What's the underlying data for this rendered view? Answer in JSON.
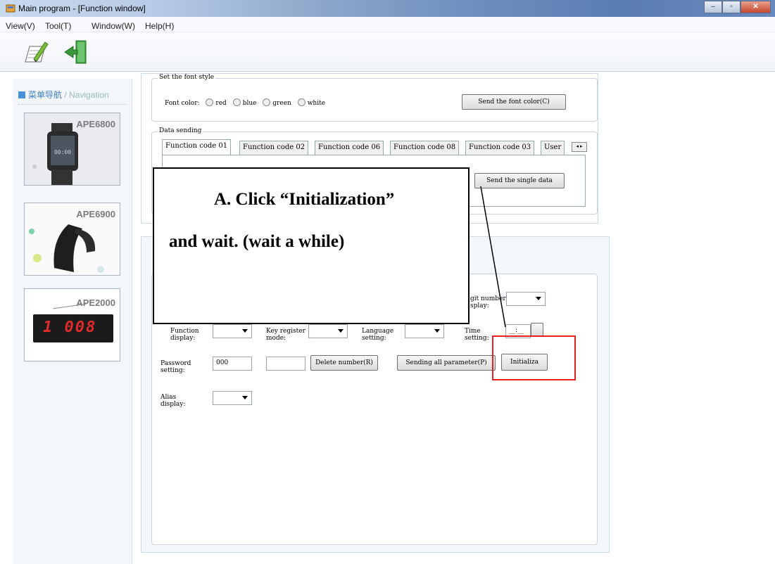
{
  "window": {
    "title": "Main program - [Function window]",
    "min": "–",
    "max": "▫",
    "close": "✕"
  },
  "menu": [
    "View(V)",
    "Tool(T)",
    "Window(W)",
    "Help(H)"
  ],
  "nav": {
    "heading_cn": "菜单导航",
    "heading_sep": " / ",
    "heading_en": "Navigation",
    "devices": [
      "APE6800",
      "APE6900",
      "APE2000"
    ],
    "display_digits": "1  008",
    "watch_time": "00:00"
  },
  "font_style": {
    "legend": "Set the font style",
    "label": "Font color:",
    "options": [
      "red",
      "blue",
      "green",
      "white"
    ],
    "send_button": "Send the font color(C)"
  },
  "data_sending": {
    "legend": "Data sending",
    "tabs": [
      "Function code 01",
      "Function code 02",
      "Function code 06",
      "Function code 08",
      "Function code 03",
      "User"
    ],
    "send_single": "Send the single data"
  },
  "params": {
    "digit_label": "git number\nsplay:",
    "function_display": "Function\ndisplay:",
    "key_register": "Key register\nmode:",
    "language": "Language\nsetting:",
    "time": "Time\nsetting:",
    "time_value": "__:__",
    "password_label": "Password\nsetting:",
    "password_value": "000",
    "delete_number": "Delete number(R)",
    "send_all": "Sending all parameter(P)",
    "initialize": "Initializa",
    "alias_label": "Alias\ndisplay:"
  },
  "callout": {
    "line1": "A.  Click  “Initialization”",
    "line2": "and wait. (wait a while)"
  },
  "colors": {
    "highlight": "#e52020",
    "nav_accent": "#3c7fc2"
  }
}
